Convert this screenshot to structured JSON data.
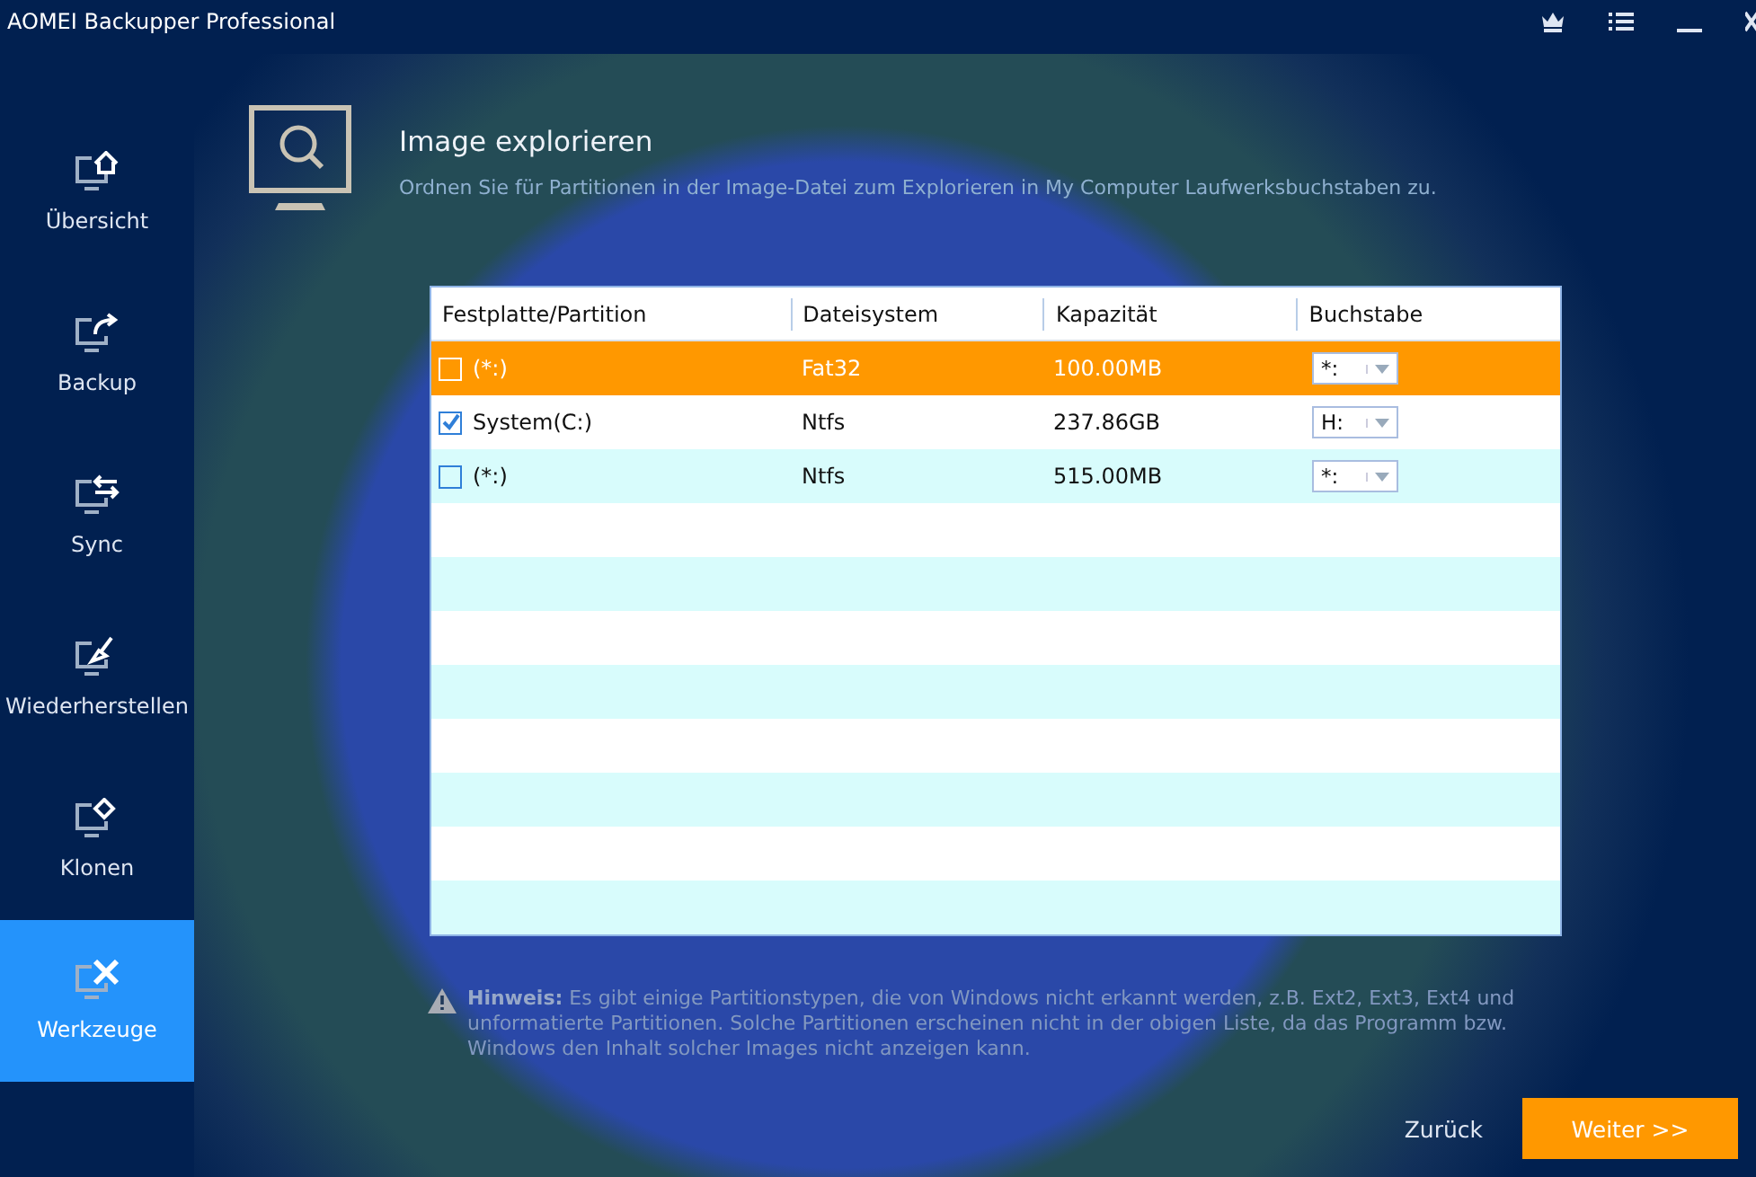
{
  "window": {
    "title": "AOMEI Backupper Professional"
  },
  "sidebar": {
    "items": [
      {
        "label": "Übersicht",
        "kind": "home",
        "selected": false
      },
      {
        "label": "Backup",
        "kind": "share",
        "selected": false
      },
      {
        "label": "Sync",
        "kind": "sync",
        "selected": false
      },
      {
        "label": "Wiederherstellen",
        "kind": "restore",
        "selected": false
      },
      {
        "label": "Klonen",
        "kind": "clone",
        "selected": false
      },
      {
        "label": "Werkzeuge",
        "kind": "tools",
        "selected": true
      }
    ]
  },
  "header": {
    "title": "Image explorieren",
    "description": "Ordnen Sie für Partitionen in der Image-Datei zum Explorieren in My Computer Laufwerksbuchstaben zu."
  },
  "table": {
    "columns": [
      "Festplatte/Partition",
      "Dateisystem",
      "Kapazität",
      "Buchstabe"
    ],
    "rows": [
      {
        "partition": "(*:)",
        "filesystem": "Fat32",
        "capacity": "100.00MB",
        "letter": "*:",
        "checked": false,
        "selected": true
      },
      {
        "partition": "System(C:)",
        "filesystem": "Ntfs",
        "capacity": "237.86GB",
        "letter": "H:",
        "checked": true,
        "selected": false
      },
      {
        "partition": "(*:)",
        "filesystem": "Ntfs",
        "capacity": "515.00MB",
        "letter": "*:",
        "checked": false,
        "selected": false
      }
    ]
  },
  "note": "**Hinweis:** Es gibt einige Partitionstypen, die von Windows nicht erkannt werden, z.B. Ext2, Ext3, Ext4 und unformatierte Partitionen. Solche Partitionen erscheinen nicht in der obigen Liste, da das Programm bzw. Windows den Inhalt solcher Images nicht anzeigen kann.",
  "buttons": {
    "back": "Zurück",
    "next": "Weiter >>"
  }
}
